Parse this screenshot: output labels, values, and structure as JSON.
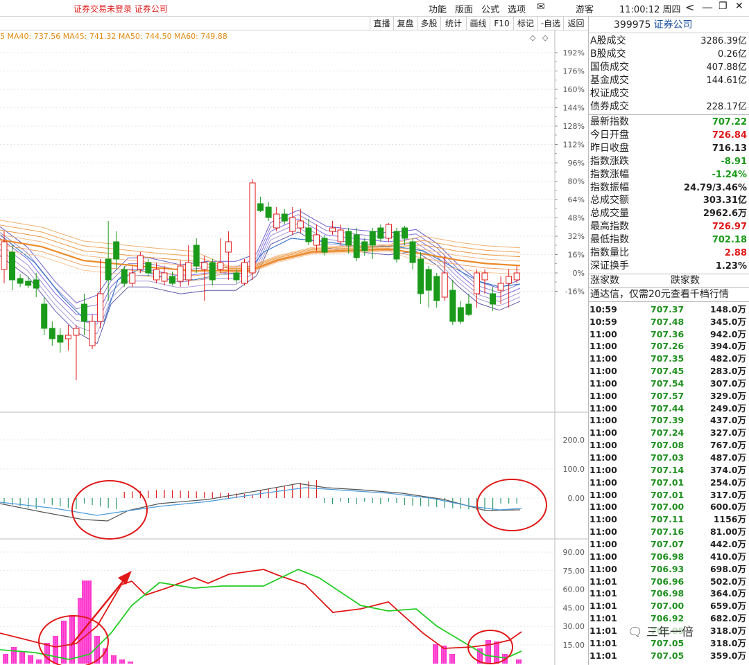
{
  "titlebar": {
    "trade_status": "证券交易未登录  证券公司",
    "menu": [
      "功能",
      "版面",
      "公式",
      "选项",
      "游客"
    ],
    "clock": "11:00:12 周四",
    "buttons": [
      "<",
      "—",
      "❐",
      "✕"
    ]
  },
  "toolbar": {
    "buttons": [
      "直播",
      "复盘",
      "多股",
      "统计",
      "画线",
      "F10",
      "标记",
      "-自选",
      "返回"
    ]
  },
  "ma_legend": "5  MA40: 737.56  MA45: 741.32  MA50: 744.50  MA60: 749.88",
  "chart_axes": {
    "main_ticks": [
      "192%",
      "176%",
      "160%",
      "144%",
      "128%",
      "112%",
      "96%",
      "80%",
      "64%",
      "48%",
      "32%",
      "16%",
      "0%",
      "-16%"
    ],
    "macd_ticks": [
      "200.0",
      "100.0",
      "0.00"
    ],
    "kdj_ticks": [
      "90.00",
      "75.00",
      "60.00",
      "45.00",
      "30.00",
      "15.00"
    ]
  },
  "panel": {
    "code": "399975",
    "name": "证券公司",
    "volumes": [
      {
        "label": "A股成交",
        "value": "3286.39亿",
        "color": "blk"
      },
      {
        "label": "B股成交",
        "value": "0.26亿",
        "color": "blk"
      },
      {
        "label": "国债成交",
        "value": "407.88亿",
        "color": "blk"
      },
      {
        "label": "基金成交",
        "value": "144.61亿",
        "color": "blk"
      },
      {
        "label": "权证成交",
        "value": "",
        "color": "blk"
      },
      {
        "label": "债券成交",
        "value": "228.17亿",
        "color": "blk"
      }
    ],
    "quotes": [
      {
        "label": "最新指数",
        "value": "707.22",
        "color": "green"
      },
      {
        "label": "今日开盘",
        "value": "726.84",
        "color": "red"
      },
      {
        "label": "昨日收盘",
        "value": "716.13",
        "color": "blk"
      },
      {
        "label": "指数涨跌",
        "value": "-8.91",
        "color": "green"
      },
      {
        "label": "指数涨幅",
        "value": "-1.24%",
        "color": "green"
      },
      {
        "label": "指数振幅",
        "value": "24.79/3.46%",
        "color": "blk"
      },
      {
        "label": "总成交额",
        "value": "303.31亿",
        "color": "blk"
      },
      {
        "label": "总成交量",
        "value": "2962.6万",
        "color": "blk"
      },
      {
        "label": "最高指数",
        "value": "726.97",
        "color": "red"
      },
      {
        "label": "最低指数",
        "value": "702.18",
        "color": "green"
      },
      {
        "label": "指数量比",
        "value": "2.88",
        "color": "red"
      },
      {
        "label": "深证换手",
        "value": "1.23%",
        "color": "blk"
      }
    ],
    "updown_header": [
      "涨家数",
      "跌家数"
    ],
    "promo": "通达信，仅需20元查看千档行情",
    "ticks": [
      [
        "10:59",
        "707.37",
        "148.0万"
      ],
      [
        "10:59",
        "707.48",
        "345.0万"
      ],
      [
        "11:00",
        "707.36",
        "942.0万"
      ],
      [
        "11:00",
        "707.26",
        "394.0万"
      ],
      [
        "11:00",
        "707.35",
        "482.0万"
      ],
      [
        "11:00",
        "707.45",
        "283.0万"
      ],
      [
        "11:00",
        "707.54",
        "307.0万"
      ],
      [
        "11:00",
        "707.57",
        "329.0万"
      ],
      [
        "11:00",
        "707.44",
        "249.0万"
      ],
      [
        "11:00",
        "707.39",
        "437.0万"
      ],
      [
        "11:00",
        "707.24",
        "327.0万"
      ],
      [
        "11:00",
        "707.08",
        "767.0万"
      ],
      [
        "11:00",
        "707.03",
        "487.0万"
      ],
      [
        "11:00",
        "707.14",
        "374.0万"
      ],
      [
        "11:00",
        "707.01",
        "254.0万"
      ],
      [
        "11:00",
        "707.01",
        "317.0万"
      ],
      [
        "11:00",
        "707.00",
        "600.0万"
      ],
      [
        "11:00",
        "707.11",
        "1156万"
      ],
      [
        "11:00",
        "707.16",
        "81.00万"
      ],
      [
        "11:00",
        "707.07",
        "442.0万"
      ],
      [
        "11:00",
        "706.98",
        "410.0万"
      ],
      [
        "11:00",
        "706.93",
        "698.0万"
      ],
      [
        "11:01",
        "706.96",
        "502.0万"
      ],
      [
        "11:01",
        "706.98",
        "364.0万"
      ],
      [
        "11:01",
        "707.00",
        "659.0万"
      ],
      [
        "11:01",
        "706.92",
        "682.0万"
      ],
      [
        "11:01",
        "707.05",
        "318.0万"
      ],
      [
        "11:01",
        "707.05",
        "318.0万"
      ],
      [
        "11:01",
        "707.05",
        "359.0万"
      ]
    ]
  },
  "watermark": "三年一倍",
  "colors": {
    "up": "#e01818",
    "down": "#1a9a1a",
    "grid": "#dcdcdc"
  }
}
